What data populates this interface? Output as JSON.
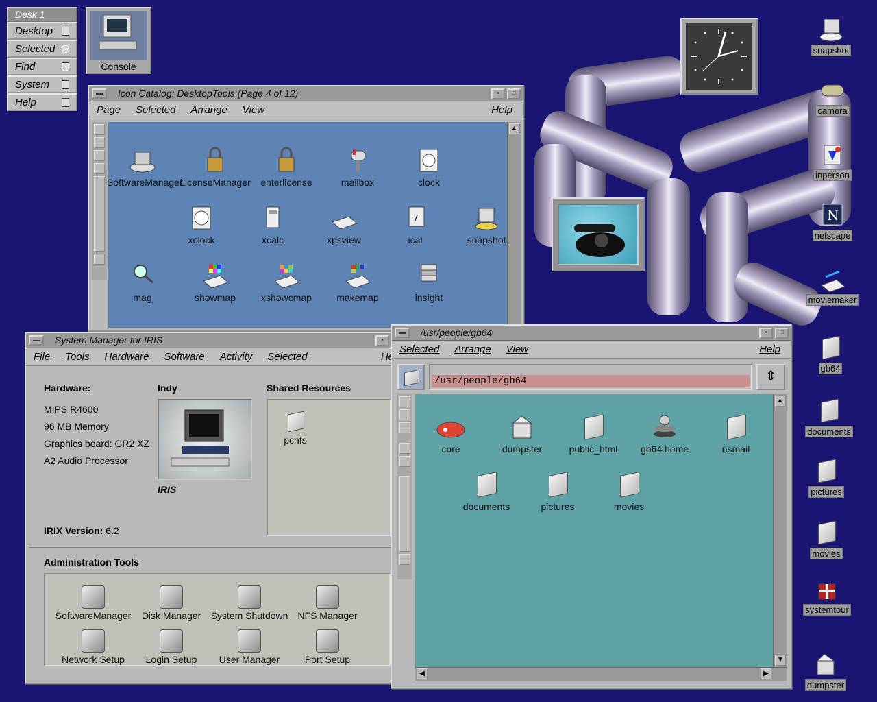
{
  "desk_panel": {
    "header": "Desk 1",
    "items": [
      "Desktop",
      "Selected",
      "Find",
      "System",
      "Help"
    ]
  },
  "console_label": "Console",
  "icon_catalog": {
    "title": "Icon Catalog: DesktopTools (Page 4 of 12)",
    "menu": [
      "Page",
      "Selected",
      "Arrange",
      "View"
    ],
    "menu_help": "Help",
    "icons": [
      "SoftwareManager",
      "LicenseManager",
      "enterlicense",
      "mailbox",
      "clock",
      "xclock",
      "xcalc",
      "xpsview",
      "ical",
      "snapshot",
      "mag",
      "showmap",
      "xshowcmap",
      "makemap",
      "insight"
    ]
  },
  "system_manager": {
    "title": "System Manager for IRIS",
    "menu": [
      "File",
      "Tools",
      "Hardware",
      "Software",
      "Activity",
      "Selected"
    ],
    "menu_help": "He",
    "hardware_label": "Hardware:",
    "hardware_specs": [
      "MIPS R4600",
      "96 MB Memory",
      "Graphics board: GR2 XZ",
      "A2 Audio Processor"
    ],
    "machine_model": "Indy",
    "machine_name": "IRIS",
    "irix_label": "IRIX Version:",
    "irix_version": "6.2",
    "shared_title": "Shared Resources",
    "shared_items": [
      "pcnfs"
    ],
    "admin_title": "Administration Tools",
    "admin_tools": [
      "SoftwareManager",
      "Disk Manager",
      "System Shutdown",
      "NFS Manager",
      "Network Setup",
      "Login Setup",
      "User Manager",
      "Port Setup"
    ]
  },
  "file_manager": {
    "title": "/usr/people/gb64",
    "menu": [
      "Selected",
      "Arrange",
      "View"
    ],
    "menu_help": "Help",
    "path": "/usr/people/gb64",
    "items": [
      "core",
      "dumpster",
      "public_html",
      "gb64.home",
      "nsmail",
      "documents",
      "pictures",
      "movies"
    ]
  },
  "desktop_icons": [
    "snapshot",
    "camera",
    "inperson",
    "netscape",
    "moviemaker",
    "gb64",
    "documents",
    "pictures",
    "movies",
    "systemtour",
    "dumpster"
  ],
  "colors": {
    "desktop": "#1a1572",
    "catalog_bg": "#5e83b5",
    "files_bg": "#5fa3a6",
    "path_bg": "#c99090"
  }
}
